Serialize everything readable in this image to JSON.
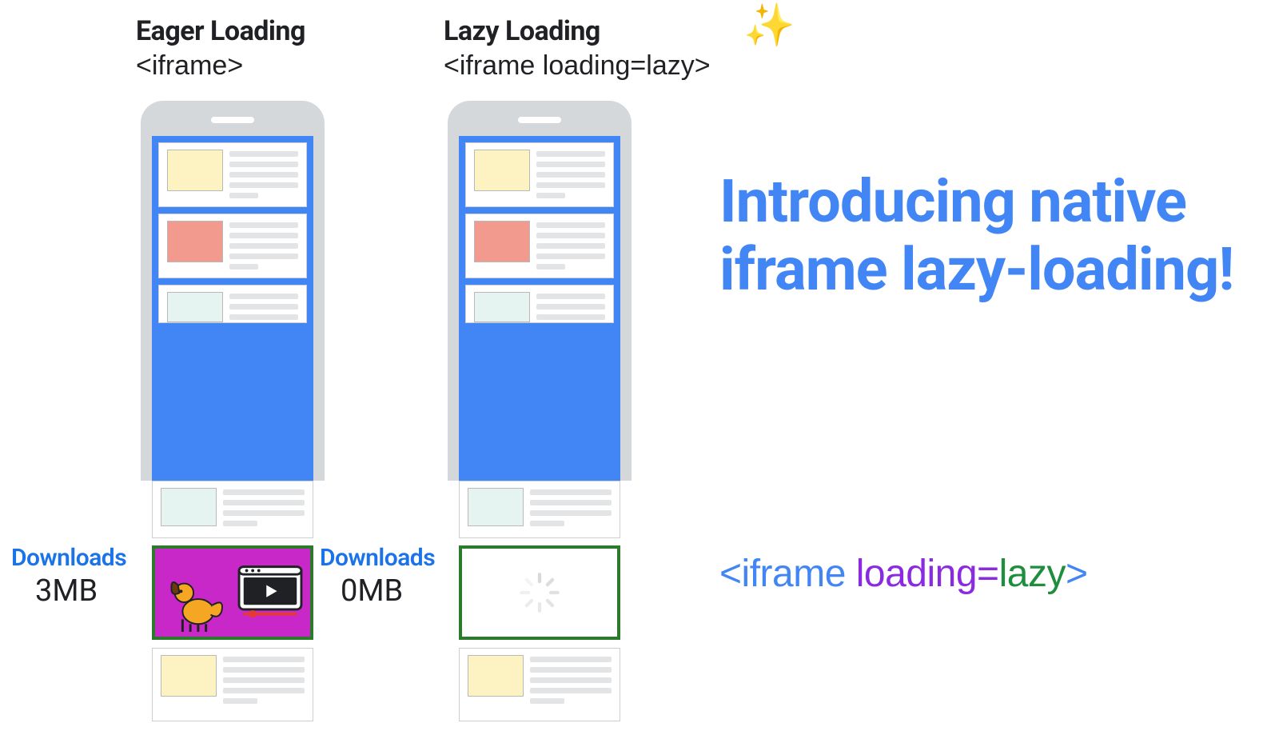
{
  "columns": {
    "eager": {
      "title": "Eager Loading",
      "code": "<iframe>",
      "download_label": "Downloads",
      "download_value": "3MB"
    },
    "lazy": {
      "title": "Lazy Loading",
      "code": "<iframe loading=lazy>",
      "download_label": "Downloads",
      "download_value": "0MB"
    }
  },
  "headline": "Introducing native iframe lazy-loading!",
  "snippet": {
    "open": "<iframe ",
    "attr": "loading=",
    "val": "lazy",
    "close": ">"
  },
  "icons": {
    "sparkles": "✨",
    "dog": "dog-icon",
    "video": "video-player-icon",
    "spinner": "loading-spinner-icon"
  }
}
